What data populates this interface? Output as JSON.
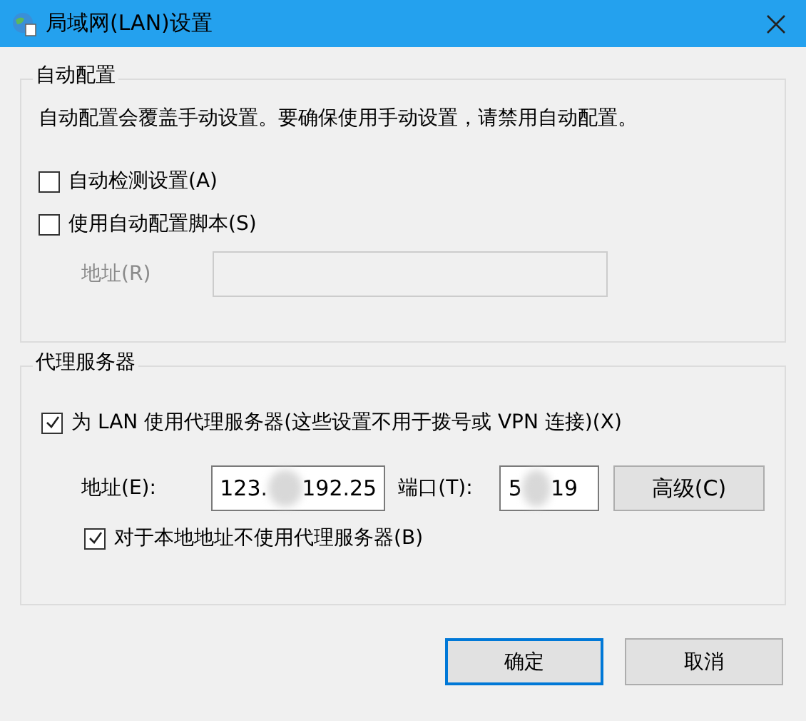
{
  "window": {
    "title": "局域网(LAN)设置"
  },
  "auto_config": {
    "title": "自动配置",
    "description": "自动配置会覆盖手动设置。要确保使用手动设置，请禁用自动配置。",
    "options": [
      {
        "label": "自动检测设置(A)",
        "checked": false
      },
      {
        "label": "使用自动配置脚本(S)",
        "checked": false
      }
    ],
    "address": {
      "label": "地址(R)",
      "disabled": true
    }
  },
  "proxy": {
    "title": "代理服务器",
    "use_proxy": {
      "label": "为 LAN 使用代理服务器(这些设置不用于拨号或 VPN 连接)(X)",
      "checked": true
    },
    "address": {
      "label": "地址(E):",
      "value_start": "123.",
      "value_end": "192.25"
    },
    "port": {
      "label": "端口(T):",
      "value_start": "5",
      "value_end": "19"
    },
    "advanced_button": "高级(C)",
    "bypass_local": {
      "label": "对于本地地址不使用代理服务器(B)",
      "checked": true
    }
  },
  "buttons": [
    {
      "label": "确定",
      "default": true
    },
    {
      "label": "取消",
      "default": false
    }
  ]
}
